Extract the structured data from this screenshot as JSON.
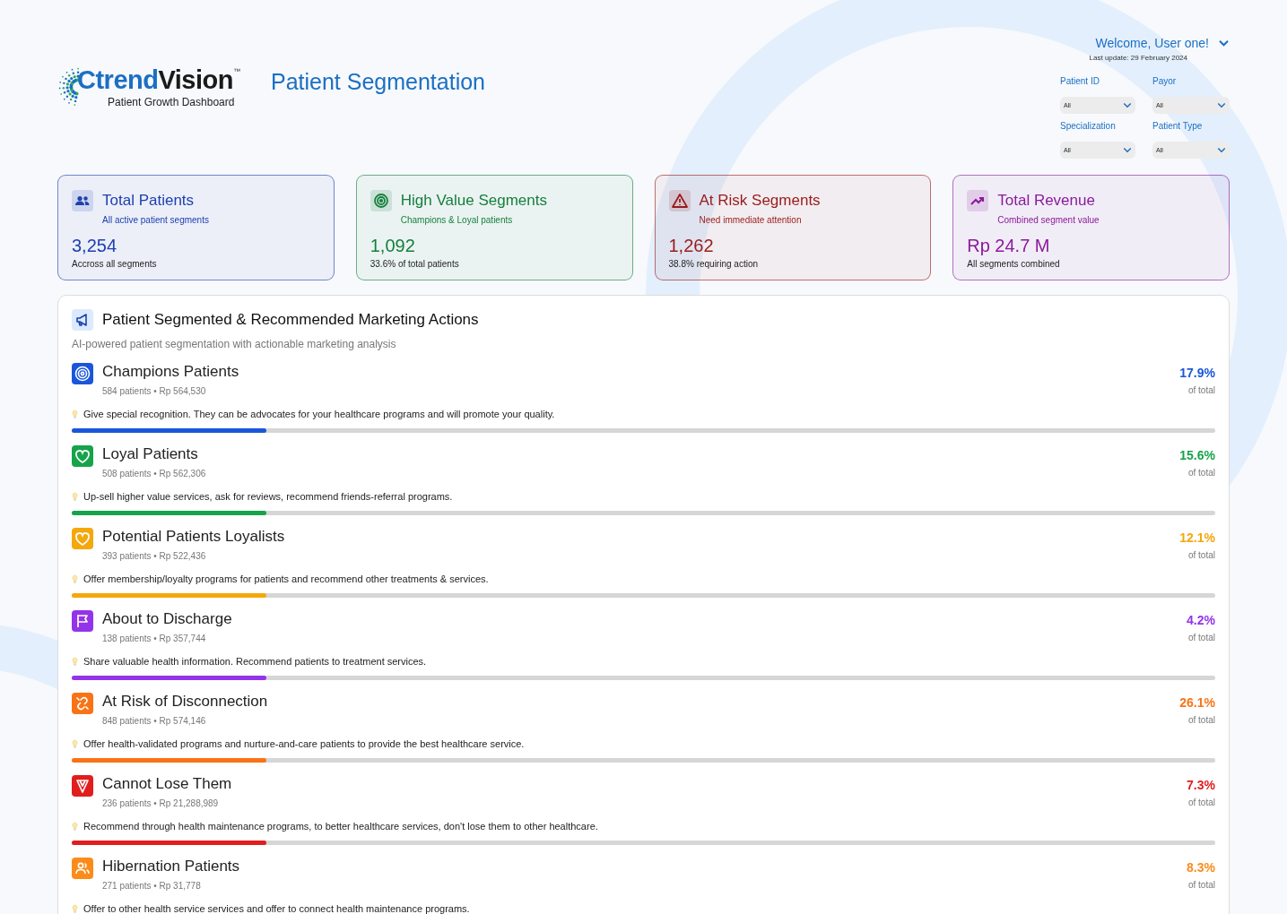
{
  "logo": {
    "brand_blue": "Ctrend",
    "brand_dark": "Vision",
    "trademark": "™",
    "tagline": "Patient Growth Dashboard"
  },
  "page_title": "Patient Segmentation",
  "user": {
    "welcome": "Welcome, User one!",
    "last_update": "Last update: 29 February 2024"
  },
  "filters": [
    {
      "label": "Patient ID",
      "value": "All"
    },
    {
      "label": "Payor",
      "value": "All"
    },
    {
      "label": "Specialization",
      "value": "All"
    },
    {
      "label": "Patient Type",
      "value": "All"
    }
  ],
  "cards": [
    {
      "kind": "users",
      "color": "#1e40af",
      "title": "Total Patients",
      "subtitle": "All active patient segments",
      "value": "3,254",
      "note": "Accross all segments"
    },
    {
      "kind": "target",
      "color": "#15803d",
      "title": "High Value Segments",
      "subtitle": "Champions & Loyal patients",
      "value": "1,092",
      "note": "33.6% of total patients"
    },
    {
      "kind": "warning",
      "color": "#991b1b",
      "title": "At Risk Segments",
      "subtitle": "Need immediate attention",
      "value": "1,262",
      "note": "38.8% requiring action"
    },
    {
      "kind": "trend",
      "color": "#8b1a9b",
      "title": "Total Revenue",
      "subtitle": "Combined segment value",
      "value": "Rp 24.7 M",
      "note": "All segments combined"
    }
  ],
  "panel": {
    "title": "Patient Segmented & Recommended Marketing Actions",
    "subtitle": "AI-powered patient segmentation with actionable marketing analysis"
  },
  "segments": [
    {
      "kind": "target",
      "color": "#1a56db",
      "name": "Champions Patients",
      "stats": "584 patients • Rp 564,530",
      "percent": "17.9%",
      "percent_note": "of total",
      "action": "Give special recognition. They can be advocates for your healthcare programs and will promote your quality.",
      "level": 0.17
    },
    {
      "kind": "heart",
      "color": "#16a34a",
      "name": "Loyal Patients",
      "stats": "508 patients • Rp 562,306",
      "percent": "15.6%",
      "percent_note": "of total",
      "action": "Up-sell higher value services, ask for reviews, recommend friends-referral programs.",
      "level": 0.17
    },
    {
      "kind": "heart",
      "color": "#f5a70b",
      "name": "Potential Patients Loyalists",
      "stats": "393 patients • Rp 522,436",
      "percent": "12.1%",
      "percent_note": "of total",
      "action": "Offer membership/loyalty programs for patients and recommend other treatments & services.",
      "level": 0.17
    },
    {
      "kind": "flag",
      "color": "#9333ea",
      "name": "About to Discharge",
      "stats": "138 patients • Rp 357,744",
      "percent": "4.2%",
      "percent_note": "of total",
      "action": "Share valuable health information. Recommend patients to treatment services.",
      "level": 0.17
    },
    {
      "kind": "unlink",
      "color": "#f97316",
      "name": "At Risk of Disconnection",
      "stats": "848 patients • Rp 574,146",
      "percent": "26.1%",
      "percent_note": "of total",
      "action": "Offer health-validated programs and nurture-and-care patients to provide the best healthcare service.",
      "level": 0.17
    },
    {
      "kind": "gem",
      "color": "#e11d1d",
      "name": "Cannot Lose Them",
      "stats": "236 patients • Rp 21,288,989",
      "percent": "7.3%",
      "percent_note": "of total",
      "action": "Recommend through health maintenance programs, to better healthcare services, don't lose them to other healthcare.",
      "level": 0.17
    },
    {
      "kind": "users",
      "color": "#fb8c1a",
      "name": "Hibernation Patients",
      "stats": "271 patients • Rp 31,778",
      "percent": "8.3%",
      "percent_note": "of total",
      "action": "Offer to other health service services and offer to connect health maintenance programs."
    }
  ]
}
